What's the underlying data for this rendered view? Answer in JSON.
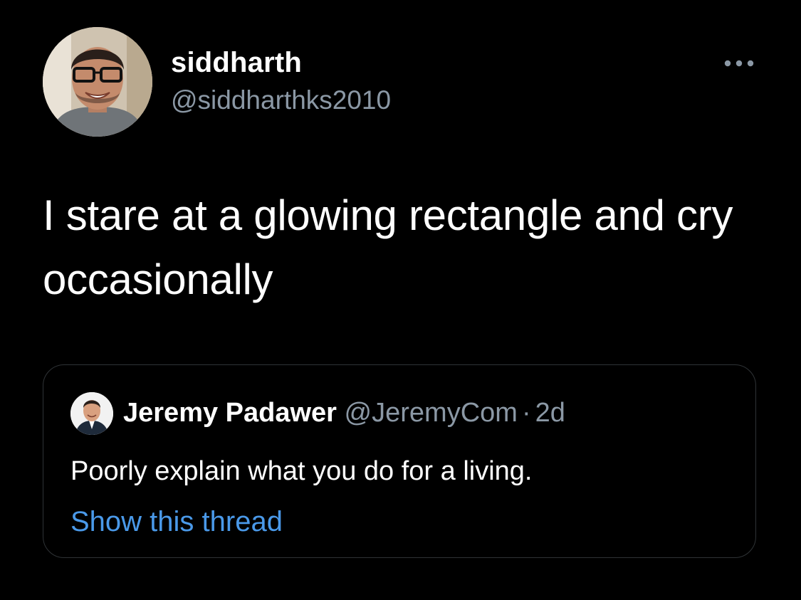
{
  "tweet": {
    "display_name": "siddharth",
    "handle": "@siddharthks2010",
    "text": "I stare at a glowing rectangle and cry occasionally",
    "more_icon": "more-horizontal-icon"
  },
  "quoted_tweet": {
    "display_name": "Jeremy Padawer",
    "handle": "@JeremyCom",
    "separator": "·",
    "time": "2d",
    "text": "Poorly explain what you do for a living.",
    "show_thread": "Show this thread"
  },
  "colors": {
    "background": "#000000",
    "text_primary": "#ffffff",
    "text_secondary": "#8b98a5",
    "link": "#4a99e9",
    "card_border": "#2f3336"
  }
}
